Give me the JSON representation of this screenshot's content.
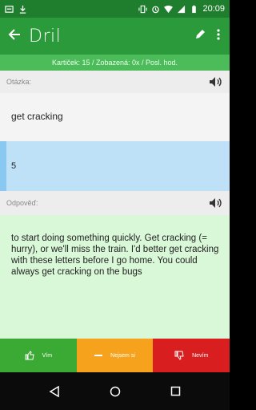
{
  "status_bar": {
    "time": "20:09"
  },
  "toolbar": {
    "app_name": "Dril"
  },
  "info_bar": {
    "text": "Kartiček: 15 / Zobazená: 0x / Posl. hod."
  },
  "question": {
    "label": "Otázka:",
    "text": "get cracking",
    "count": "5"
  },
  "answer": {
    "label": "Odpověď:",
    "text": "to start doing something quickly. Get cracking (= hurry), or we'll miss the train. I'd better get cracking with these letters before I go home. You could always get cracking on the bugs"
  },
  "buttons": {
    "know": "Vím",
    "unsure": "Nejsem si",
    "dont_know": "Nevím"
  },
  "colors": {
    "toolbar": "#2a9a3a",
    "info_bar": "#4cbb5a",
    "answer_bg": "#d9f8d8",
    "count_bg": "#bfe1f7",
    "btn_green": "#3aaa35",
    "btn_orange": "#f7a21c",
    "btn_red": "#d81e1e"
  }
}
